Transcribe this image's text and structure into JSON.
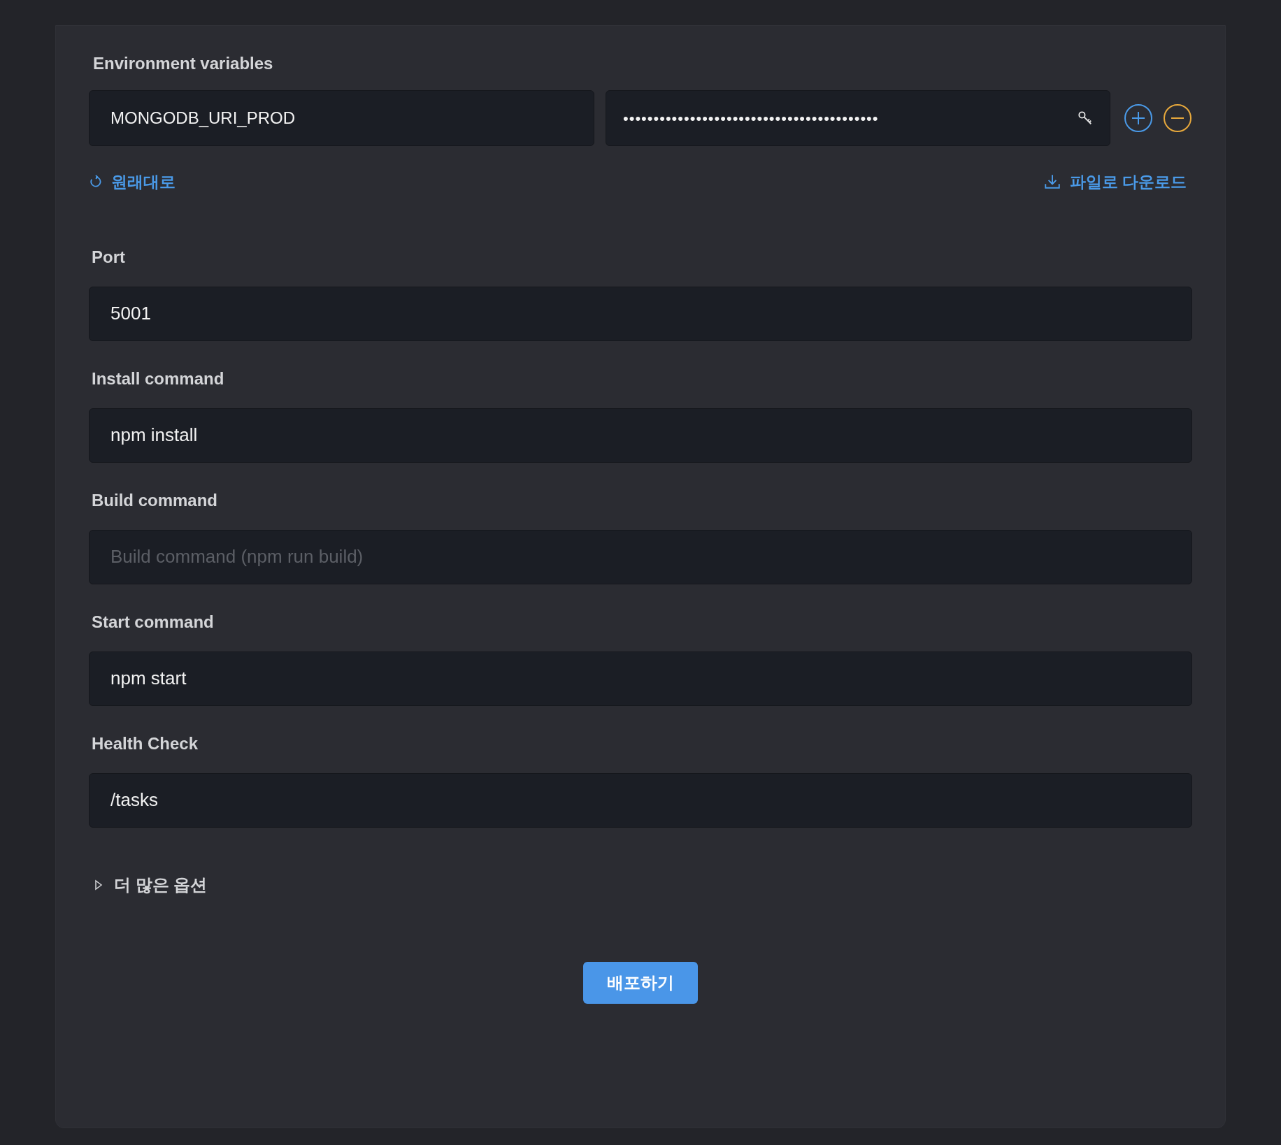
{
  "env_section": {
    "label": "Environment variables",
    "variables": [
      {
        "key": "MONGODB_URI_PROD",
        "value": "••••••••••••••••••••••••••••••••••••••••••"
      }
    ],
    "reset_link": "원래대로",
    "download_link": "파일로 다운로드"
  },
  "fields": [
    {
      "label": "Port",
      "value": "5001"
    },
    {
      "label": "Install command",
      "value": "npm install"
    },
    {
      "label": "Build command",
      "placeholder": "Build command (npm run build)"
    },
    {
      "label": "Start command",
      "value": "npm start"
    },
    {
      "label": "Health Check",
      "value": "/tasks"
    }
  ],
  "more_options": {
    "label": "더 많은 옵션",
    "expanded": false
  },
  "deploy_button": "배포하기"
}
